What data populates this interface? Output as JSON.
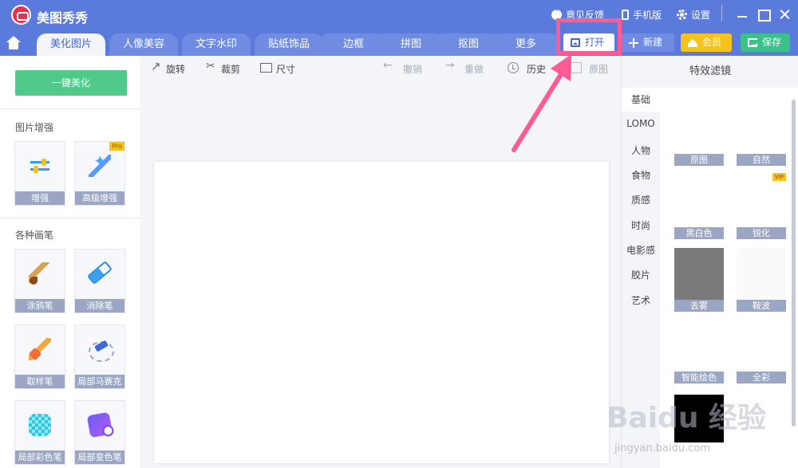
{
  "app": {
    "title": "美图秀秀",
    "logo_icon": "meitu-logo-icon"
  },
  "titlebar": {
    "feedback": "意见反馈",
    "mobile": "手机版",
    "settings": "设置"
  },
  "tabs": [
    {
      "label": "美化图片",
      "active": true
    },
    {
      "label": "人像美容"
    },
    {
      "label": "文字水印"
    },
    {
      "label": "贴纸饰品"
    },
    {
      "label": "边框"
    },
    {
      "label": "拼图"
    },
    {
      "label": "抠图"
    },
    {
      "label": "更多"
    }
  ],
  "actions": {
    "open": "打开",
    "new": "新建",
    "vip": "会员",
    "save": "保存"
  },
  "left": {
    "one_key": "一键美化",
    "section1": "图片增强",
    "section2": "各种画笔",
    "pro_badge": "Pro",
    "tools1": [
      {
        "label": "增强",
        "icon": "sliders-icon"
      },
      {
        "label": "高级增强",
        "icon": "magic-wand-icon"
      }
    ],
    "tools2": [
      {
        "label": "涂鸦笔",
        "icon": "paint-brush-icon"
      },
      {
        "label": "消除笔",
        "icon": "eraser-icon"
      },
      {
        "label": "取样笔",
        "icon": "sample-brush-icon"
      },
      {
        "label": "局部马赛克",
        "icon": "mosaic-pen-icon"
      },
      {
        "label": "局部彩色笔",
        "icon": "mosaic-color-icon"
      },
      {
        "label": "局部变色笔",
        "icon": "color-change-icon"
      }
    ]
  },
  "canvas_toolbar": {
    "rotate": "旋转",
    "crop": "裁剪",
    "size": "尺寸",
    "undo": "撤销",
    "redo": "重做",
    "history": "历史",
    "original": "原图"
  },
  "right": {
    "title": "特效滤镜",
    "vip_badge": "VIP",
    "categories": [
      "基础",
      "LOMO",
      "人物",
      "食物",
      "质感",
      "时尚",
      "电影感",
      "胶片",
      "艺术"
    ],
    "filters": [
      "原图",
      "自然",
      "黑白色",
      "锐化",
      "去雾",
      "鞍波",
      "智能绘色",
      "全彩"
    ]
  },
  "watermark": {
    "brand": "Baidu 经验",
    "url": "jingyan.baidu.com"
  },
  "colors": {
    "header": "#5b7bdc",
    "tab_active_text": "#4a67c7",
    "highlight": "#ff5c93",
    "green": "#4fca8a",
    "gold": "#f5c21e"
  }
}
